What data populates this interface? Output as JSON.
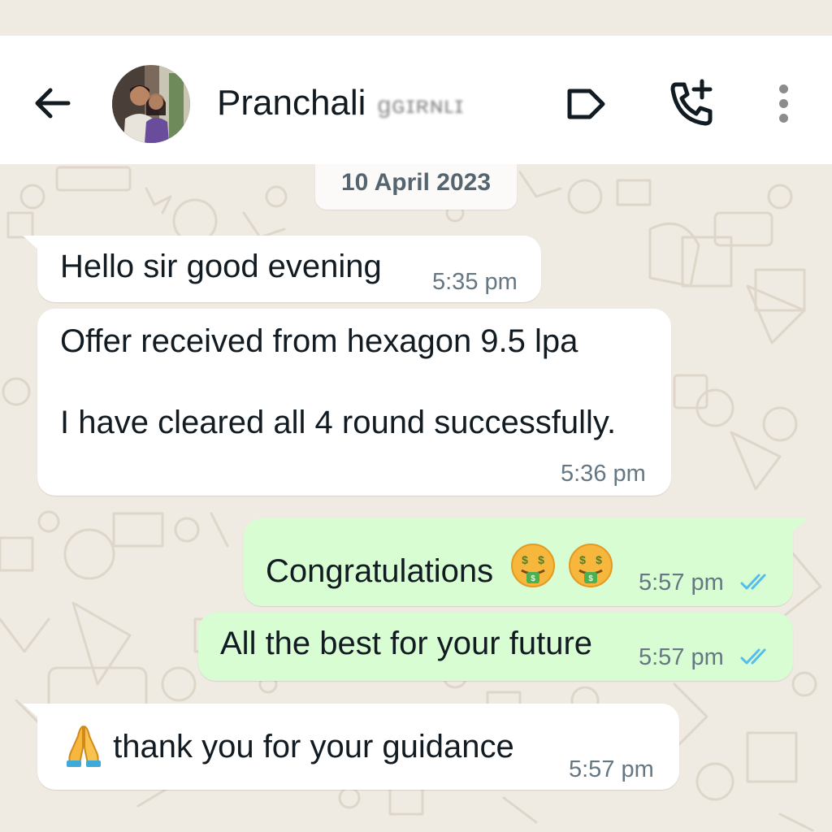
{
  "header": {
    "contact_name": "Pranchali",
    "contact_name_obscured": "ɡɢɪʀɴʟɪ"
  },
  "chat": {
    "date_chip": "10 April 2023",
    "messages": [
      {
        "direction": "incoming",
        "text": "Hello sir good evening",
        "time": "5:35 pm"
      },
      {
        "direction": "incoming",
        "text_line1": "Offer received from hexagon 9.5 lpa",
        "text_line2": "I have cleared all 4 round successfully.",
        "time": "5:36 pm"
      },
      {
        "direction": "outgoing",
        "text": "Congratulations",
        "emoji": "money-mouth-face x2",
        "time": "5:57 pm",
        "status": "read"
      },
      {
        "direction": "outgoing",
        "text": "All the best for your future",
        "time": "5:57 pm",
        "status": "read"
      },
      {
        "direction": "incoming",
        "text": "thank you for your guidance",
        "emoji": "folded-hands",
        "time": "5:57 pm"
      }
    ]
  },
  "colors": {
    "outgoing_bubble": "#d9fdd3",
    "incoming_bubble": "#ffffff",
    "chat_background": "#efeae2",
    "read_ticks": "#53bdeb"
  }
}
